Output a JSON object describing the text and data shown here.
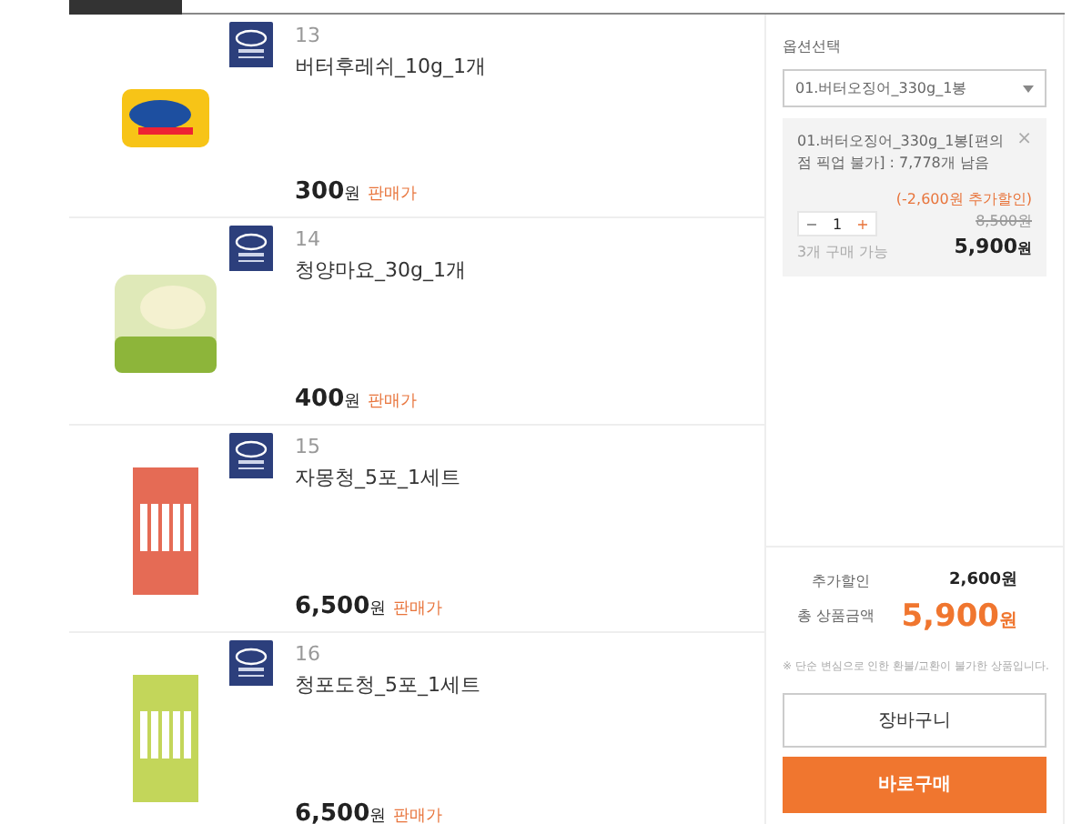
{
  "products": [
    {
      "number": "13",
      "name": "버터후레쉬_10g_1개",
      "price": "300",
      "unit": "원",
      "price_label": "판매가",
      "kind": "tub"
    },
    {
      "number": "14",
      "name": "청양마요_30g_1개",
      "price": "400",
      "unit": "원",
      "price_label": "판매가",
      "kind": "cup"
    },
    {
      "number": "15",
      "name": "자몽청_5포_1세트",
      "price": "6,500",
      "unit": "원",
      "price_label": "판매가",
      "kind": "red-sticks"
    },
    {
      "number": "16",
      "name": "청포도청_5포_1세트",
      "price": "6,500",
      "unit": "원",
      "price_label": "판매가",
      "kind": "green-sticks"
    }
  ],
  "option_panel": {
    "label": "옵션선택",
    "select_value": "01.버터오징어_330g_1봉",
    "selected_option": {
      "name": "01.버터오징어_330g_1봉[편의점 픽업 불가] : 7,778개 남음",
      "close": "×",
      "minus": "−",
      "quantity": "1",
      "plus": "+",
      "limit": "3개 구매 가능",
      "discount": "(-2,600원 추가할인)",
      "original_price": "8,500원",
      "price": "5,900",
      "price_unit": "원"
    }
  },
  "summary": {
    "discount_label": "추가할인",
    "discount": "2,600",
    "discount_unit": "원",
    "total_label": "총 상품금액",
    "total": "5,900",
    "total_unit": "원",
    "notice": "※ 단순 변심으로 인한 환불/교환이 불가한 상품입니다."
  },
  "buttons": {
    "cart": "장바구니",
    "buy": "바로구매"
  }
}
